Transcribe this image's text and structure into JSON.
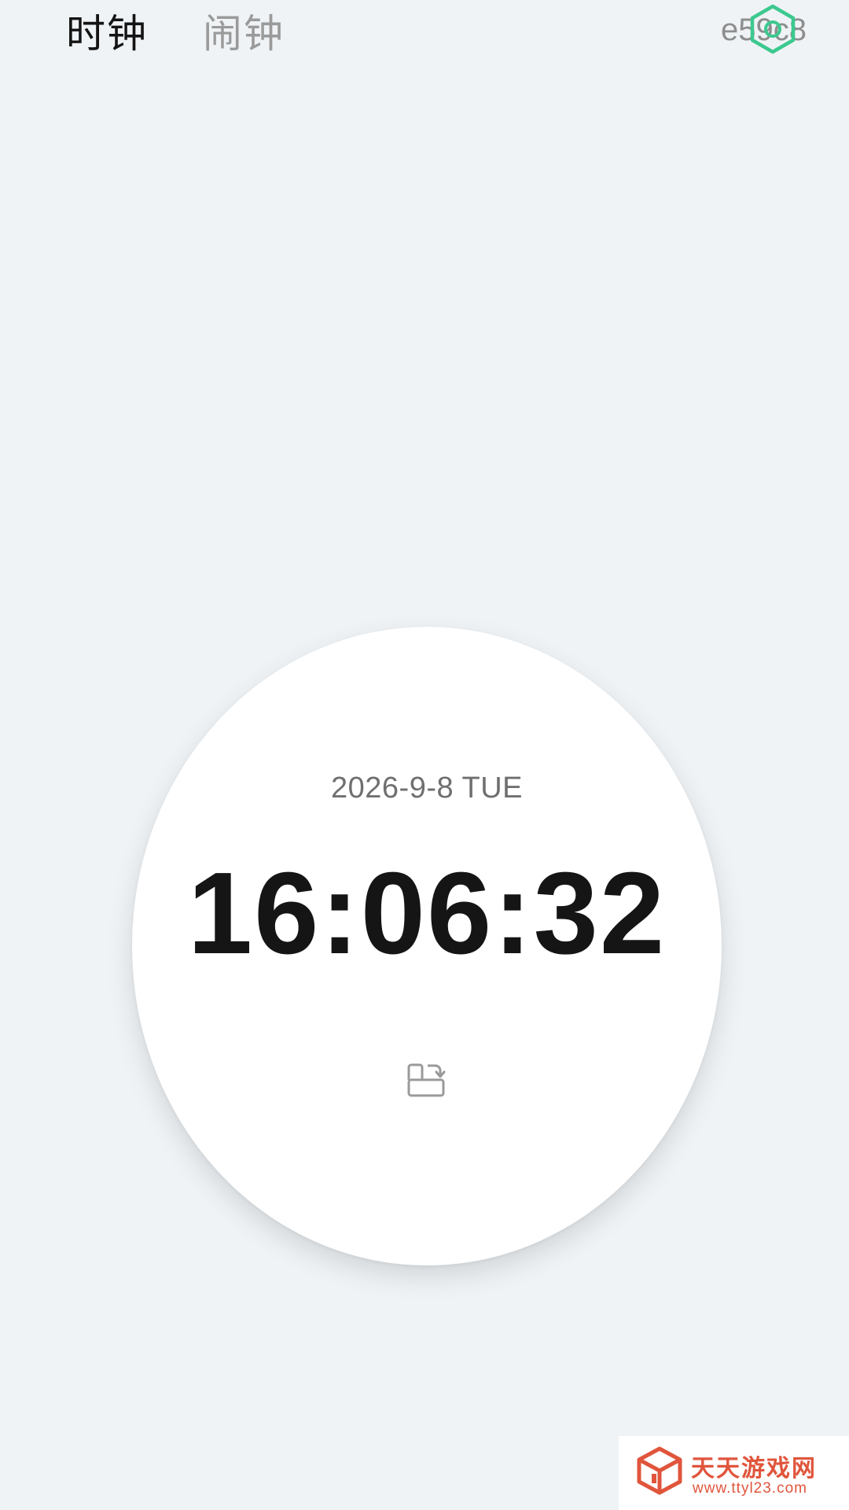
{
  "tabs": {
    "clock_label": "时钟",
    "alarm_label": "闹钟"
  },
  "corner": {
    "code_text": "e59c8",
    "icon": "hexagon-outline-icon",
    "icon_color": "#3cc98f"
  },
  "clock": {
    "date": "2026-9-8 TUE",
    "time": "16:06:32",
    "rotate_icon": "rotate-screen-icon"
  },
  "watermark": {
    "title": "天天游戏网",
    "url": "www.ttyl23.com",
    "color": "#e0553c",
    "icon": "cube-logo-icon"
  }
}
